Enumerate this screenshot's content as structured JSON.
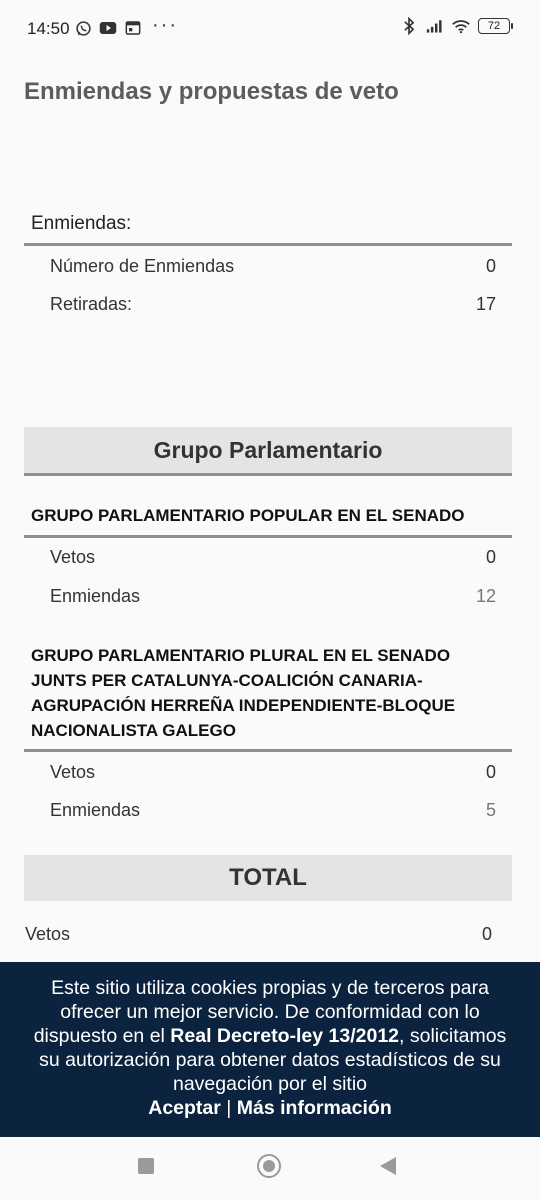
{
  "status_bar": {
    "time": "14:50",
    "battery": "72"
  },
  "page": {
    "title": "Enmiendas y propuestas de veto"
  },
  "enmiendas_section": {
    "label": "Enmiendas:",
    "rows": [
      {
        "label": "Número de Enmiendas",
        "value": "0"
      },
      {
        "label": "Retiradas:",
        "value": "17"
      }
    ]
  },
  "grupo_section": {
    "header": "Grupo Parlamentario",
    "groups": [
      {
        "name": "GRUPO PARLAMENTARIO POPULAR EN EL SENADO",
        "rows": [
          {
            "label": "Vetos",
            "value": "0"
          },
          {
            "label": "Enmiendas",
            "value": "12"
          }
        ]
      },
      {
        "name": "GRUPO PARLAMENTARIO PLURAL EN EL SENADO JUNTS PER CATALUNYA-COALICIÓN CANARIA-AGRUPACIÓN HERREÑA INDEPENDIENTE-BLOQUE NACIONALISTA GALEGO",
        "rows": [
          {
            "label": "Vetos",
            "value": "0"
          },
          {
            "label": "Enmiendas",
            "value": "5"
          }
        ]
      }
    ]
  },
  "total_section": {
    "header": "TOTAL",
    "rows": [
      {
        "label": "Vetos",
        "value": "0"
      }
    ]
  },
  "cookie_banner": {
    "text_before": "Este sitio utiliza cookies propias y de terceros para ofrecer un mejor servicio. De conformidad con lo dispuesto en el ",
    "law": "Real Decreto-ley 13/2012",
    "text_after": ", solicitamos su autorización para obtener datos estadísticos de su navegación por el sitio",
    "accept_label": "Aceptar",
    "separator": " | ",
    "more_info_label": "Más información"
  }
}
